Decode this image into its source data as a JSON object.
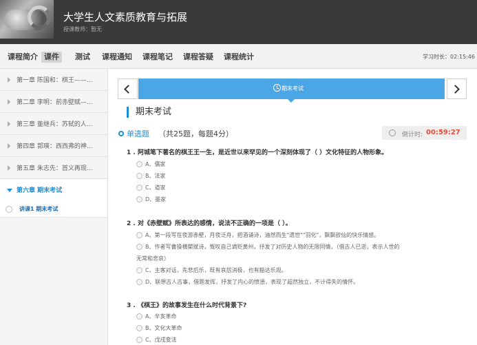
{
  "header": {
    "course_title": "大学生人文素质教育与拓展",
    "teacher": "授课教师：暂无"
  },
  "nav": {
    "items": [
      "课程简介",
      "课件",
      "测试",
      "课程通知",
      "课程笔记",
      "课程答疑",
      "课程统计"
    ],
    "active": "课件",
    "study_time": "学习时长：02:15:46"
  },
  "sidebar": {
    "chapters": [
      "第一章 陈国和：棋王——...",
      "第二章 李明：前赤壁赋—...",
      "第三章 董继兵：苏轼的人...",
      "第四章 郭瑛：西西弗的神...",
      "第五章 朱志先：首义再现..."
    ],
    "open_chapter": "第六章 期末考试",
    "lesson": "讲课1 期末考试"
  },
  "main": {
    "tab_label": "期末考试",
    "section_title": "期末考试",
    "question_type": "单选题",
    "question_desc": "（共25题，每题4分）",
    "timer_label": "倒计时:",
    "timer_value": "00:59:27",
    "questions": [
      {
        "title": "1 . 阿城笔下著名的棋王王一生，是近世以来罕见的一个深刻体现了（ ）文化特征的人物形象。",
        "options": [
          "A、儒家",
          "B、法家",
          "C、道家",
          "D、墨家"
        ]
      },
      {
        "title": "2 . 对《赤壁赋》所表达的感情，说法不正确的一项是（ ）。",
        "options": [
          "A、第一段写在夜游赤壁，月夜泛舟，把酒诵诗，油然而生\"遗世\"\"羽化\"，飘飘欲仙的快乐情感。",
          "B、作者写曹操横槊赋诗，慨叹自己谪贬黄州，抒发了对历史人物的无限同情，（借古人已逝，表示人世的",
          "C、主客对话，先悲后乐，既有哀怨消极，也有豁达乐观。",
          "D、联想古人古事，借题发挥，抒发了内心的愤懑，表现了超然独立，不计得失的情怀。"
        ],
        "option_b_cont": "无常和悲哀）"
      },
      {
        "title": "3 . 《棋王》的故事发生在什么时代背景下?",
        "options": [
          "A、辛亥革命",
          "B、文化大革命",
          "C、戊戌变法"
        ]
      }
    ]
  }
}
